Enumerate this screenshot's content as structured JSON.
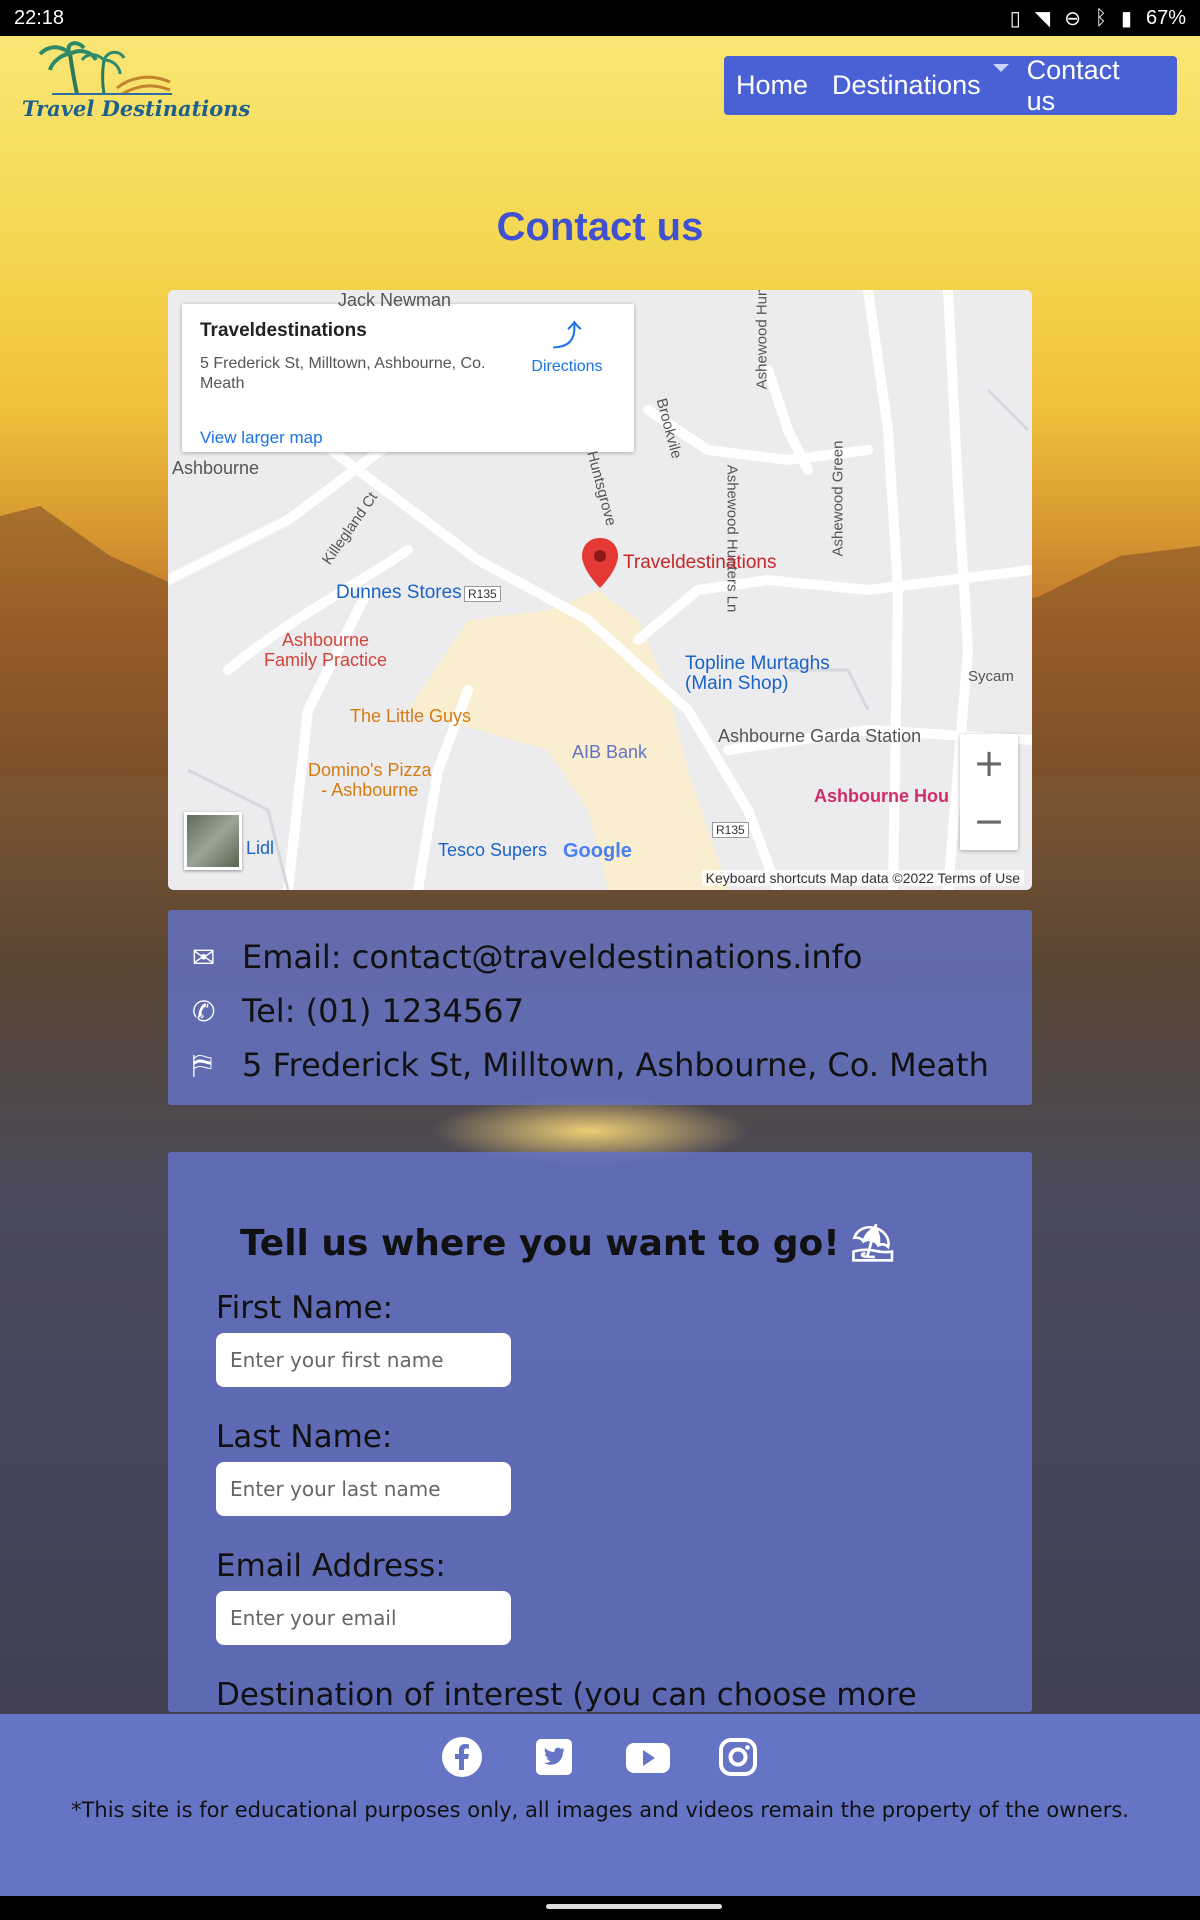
{
  "status_bar": {
    "time": "22:18",
    "battery": "67%"
  },
  "logo": {
    "text": "Travel Destinations"
  },
  "nav": {
    "items": [
      "Home",
      "Destinations",
      "Contact us"
    ]
  },
  "page_title": "Contact us",
  "map": {
    "card": {
      "place_name": "Traveldestinations",
      "address": "5 Frederick St, Milltown, Ashbourne, Co. Meath",
      "directions": "Directions",
      "view_larger": "View larger map"
    },
    "labels": {
      "jack_newman": "Jack Newman",
      "ashbourne": "Ashbourne",
      "killegland": "Killegland Ct",
      "huntsgrove": "Huntsgrove",
      "brookvile": "Brookvile",
      "ashewood_hun": "Ashewood Hun",
      "ashewood_hunters": "Ashewood Hunters Ln",
      "ashewood_green": "Ashewood Green",
      "dunnes": "Dunnes Stores",
      "r135_a": "R135",
      "r135_b": "R135",
      "marker": "Traveldestinations",
      "ashbourne_family": "Ashbourne\nFamily Practice",
      "topline": "Topline Murtaghs\n(Main Shop)",
      "little_guys": "The Little Guys",
      "aib": "AIB Bank",
      "garda": "Ashbourne Garda Station",
      "dominos": "Domino's Pizza\n- Ashbourne",
      "ashbourne_hou": "Ashbourne Hou",
      "lidl": "Lidl",
      "tesco": "Tesco Supers",
      "sycamore": "Sycam"
    },
    "google_logo": "Google",
    "footer": "Keyboard shortcuts    Map data ©2022    Terms of Use",
    "zoom_in": "+",
    "zoom_out": "−"
  },
  "contact": {
    "email": "Email: contact@traveldestinations.info",
    "tel": "Tel: (01) 1234567",
    "address": "5 Frederick St, Milltown, Ashbourne, Co. Meath"
  },
  "form": {
    "title": "Tell us where you want to go!",
    "first_name_label": "First Name:",
    "first_name_placeholder": "Enter your first name",
    "last_name_label": "Last Name:",
    "last_name_placeholder": "Enter your last name",
    "email_label": "Email Address:",
    "email_placeholder": "Enter your email",
    "destination_label": "Destination of interest (you can choose more"
  },
  "footer": {
    "disclaimer": "*This site is for educational purposes only, all images and videos remain the property of the owners."
  },
  "icons": [
    "facebook-icon",
    "twitter-icon",
    "youtube-icon",
    "instagram-icon",
    "envelope-icon",
    "phone-icon",
    "map-icon",
    "umbrella-icon"
  ]
}
